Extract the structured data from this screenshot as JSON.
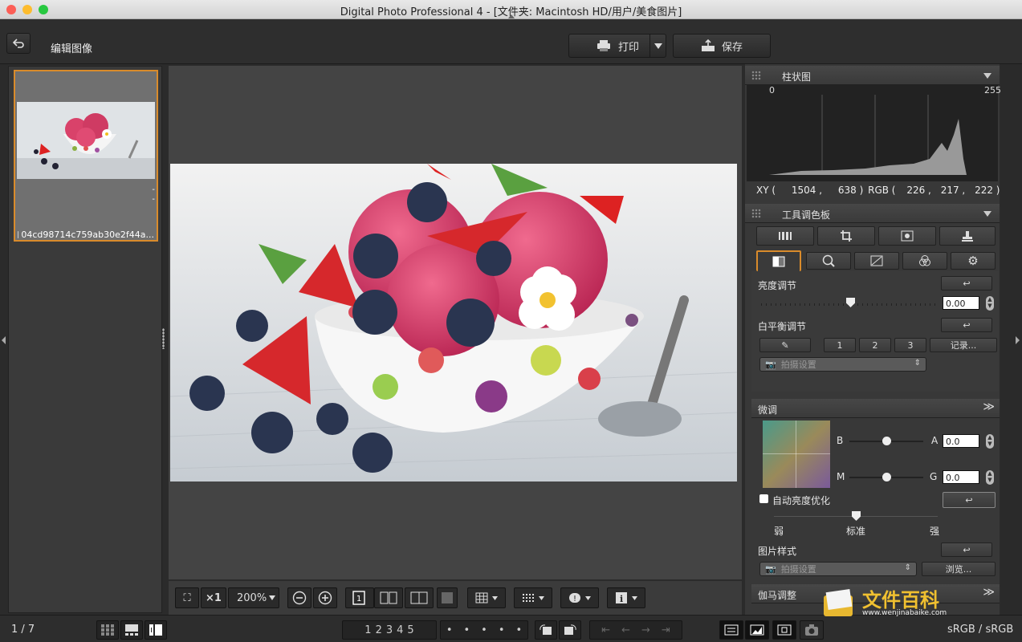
{
  "window": {
    "title": "Digital Photo Professional 4 - [文件夹: Macintosh HD/用户/美食图片]"
  },
  "toolbar": {
    "page_title": "编辑图像",
    "print_label": "打印",
    "save_label": "保存"
  },
  "thumbnail": {
    "filename": "04cd98714c759ab30e2f44a...",
    "side_marks": [
      "-",
      "-"
    ]
  },
  "histogram": {
    "title": "柱状图",
    "min_label": "0",
    "max_label": "255",
    "xy_label": "XY (",
    "x": "1504 ,",
    "y": "638 )",
    "rgb_label": "RGB (",
    "r": "226 ,",
    "g": "217 ,",
    "b": "222 )"
  },
  "tool_palette": {
    "title": "工具调色板",
    "brightness_label": "亮度调节",
    "brightness_value": "0.00",
    "brightness_level": 0.5,
    "wb_label": "白平衡调节",
    "wb_buttons": [
      "1",
      "2",
      "3",
      "记录..."
    ],
    "wb_select": "拍摄设置"
  },
  "fine_tune": {
    "title": "微调",
    "b_label": "B",
    "a_label": "A",
    "m_label": "M",
    "g_label": "G",
    "ba_value": "0.0",
    "mg_value": "0.0",
    "auto_label": "自动亮度优化",
    "weak": "弱",
    "std": "标准",
    "strong": "强"
  },
  "picture_style": {
    "label": "图片样式",
    "select": "拍摄设置",
    "browse": "浏览..."
  },
  "gamma": {
    "title": "伽马调整"
  },
  "watermark": {
    "main": "文件百科",
    "sub": "www.wenjinabaike.com"
  },
  "viewbar": {
    "fit": "⛶",
    "x1": "×1",
    "zoom": "200%"
  },
  "status": {
    "page": "1 / 7",
    "color": "sRGB / sRGB",
    "ratings": [
      "1",
      "2",
      "3",
      "4",
      "5"
    ]
  },
  "colors": {
    "accent": "#d98b2b"
  }
}
